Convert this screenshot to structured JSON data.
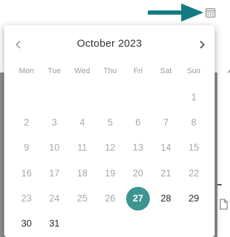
{
  "calendar": {
    "month_label": "October 2023",
    "weekdays": [
      "Mon",
      "Tue",
      "Wed",
      "Thu",
      "Fri",
      "Sat",
      "Sun"
    ],
    "first_weekday_index": 6,
    "days_in_month": 31,
    "selected_day": 27,
    "disabled_through_day": 26
  },
  "colors": {
    "accent": "#3d9493",
    "arrow": "#137b82",
    "disabled_text": "#a8a8a8",
    "enabled_text": "#2a2a2a"
  },
  "icons": {
    "top_right": "calendar-icon",
    "annotation": "arrow-right-icon",
    "prev": "chevron-left-icon",
    "next": "chevron-right-icon",
    "strip": "document-icon"
  }
}
